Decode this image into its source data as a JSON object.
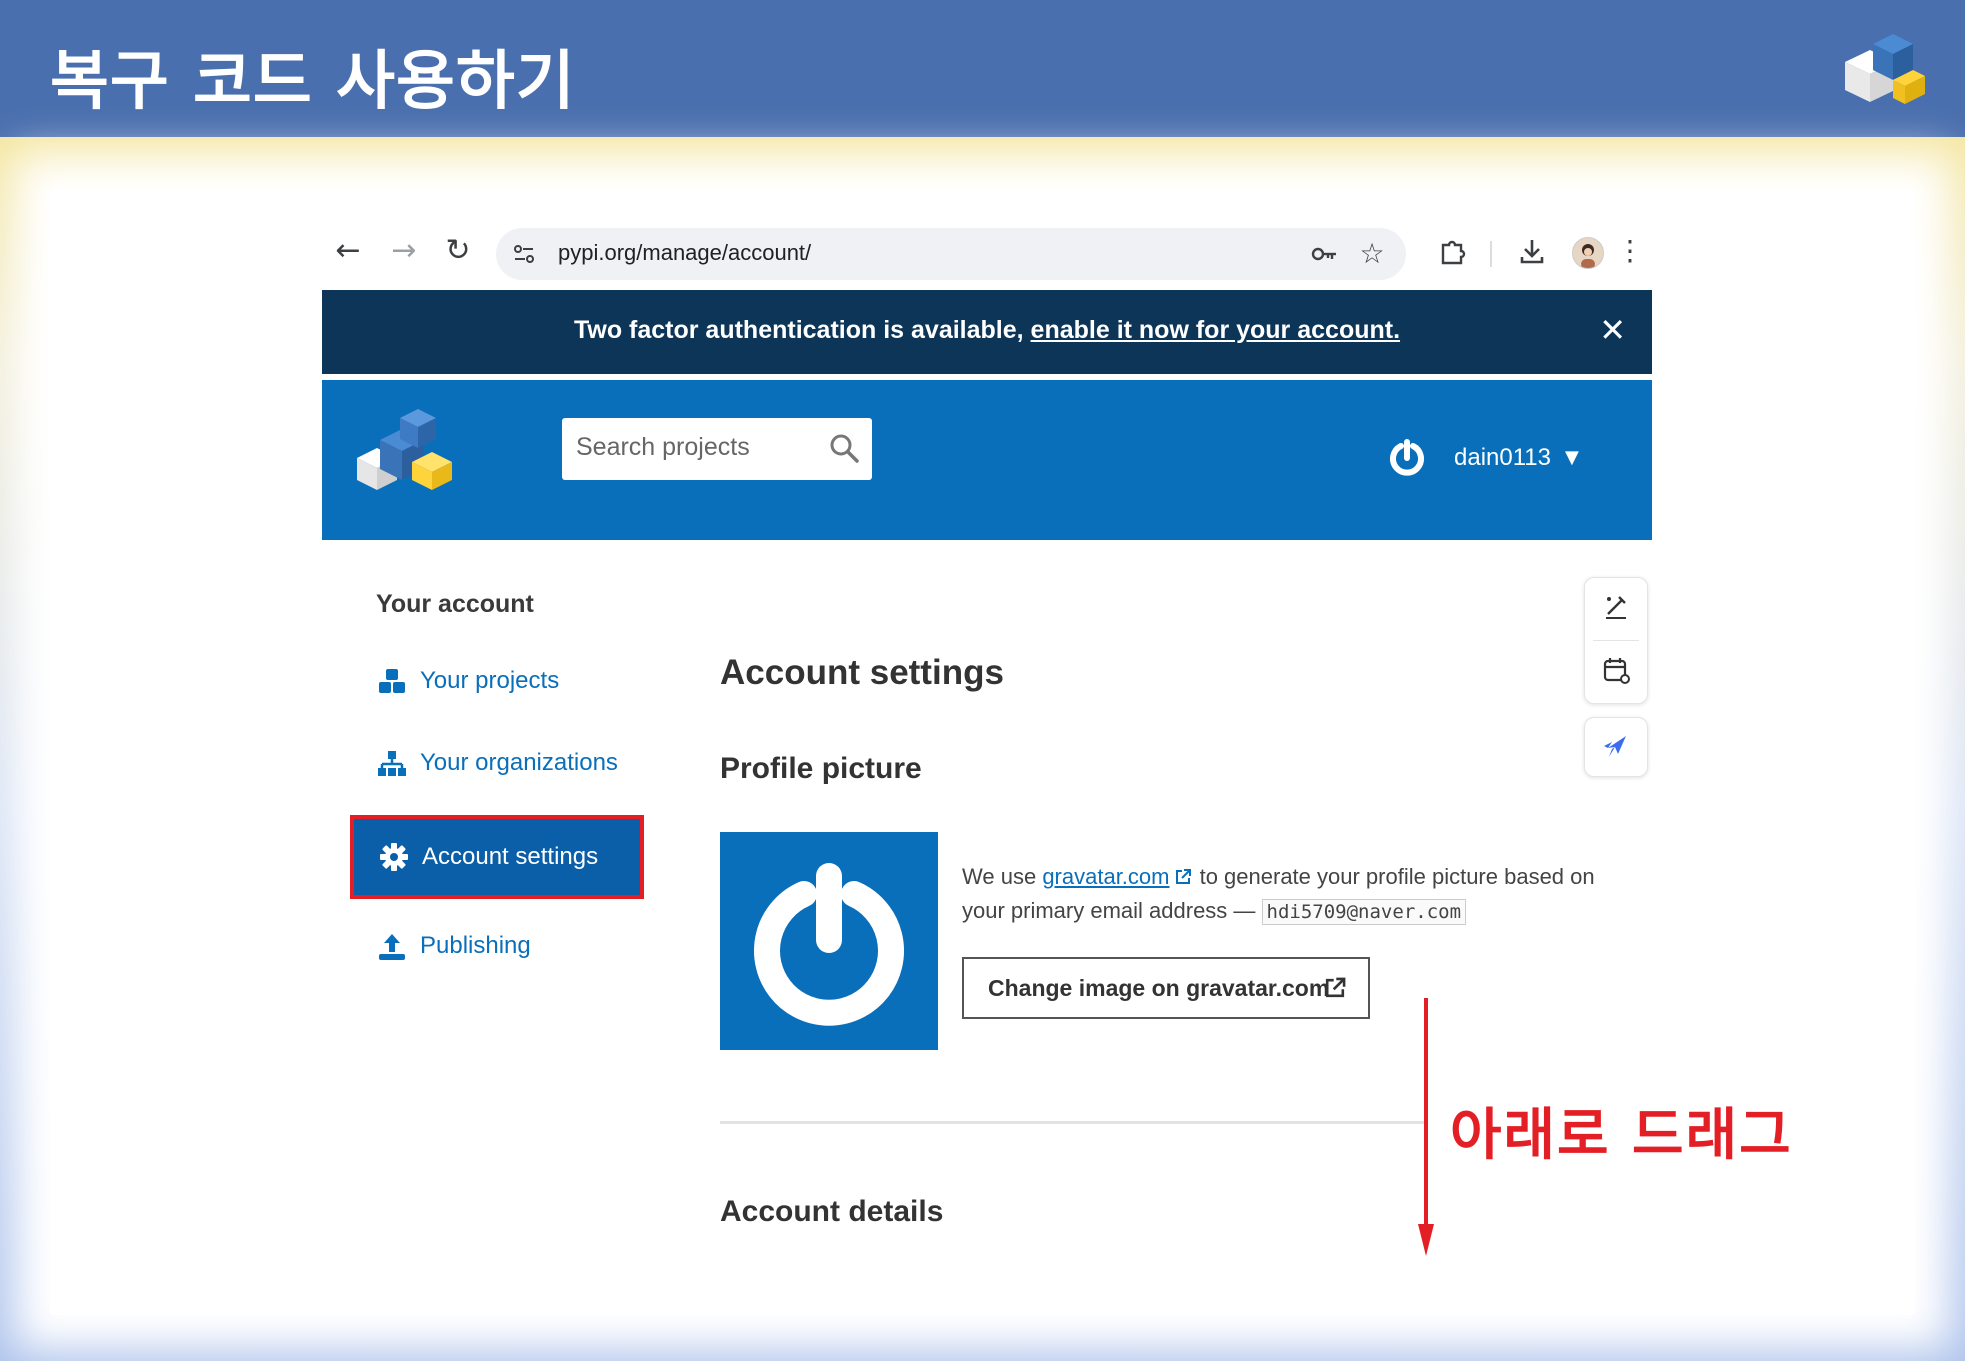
{
  "slide": {
    "title": "복구 코드 사용하기",
    "annotation": "아래로 드래그"
  },
  "browser": {
    "url": "pypi.org/manage/account/",
    "icons": [
      "back-icon",
      "forward-icon",
      "reload-icon",
      "site-info-icon",
      "key-icon",
      "star-icon",
      "extensions-icon",
      "download-icon",
      "avatar",
      "menu-icon"
    ]
  },
  "banner": {
    "text": "Two factor authentication is available, ",
    "link": "enable it now for your account.",
    "close": "✕"
  },
  "header": {
    "search_placeholder": "Search projects",
    "username": "dain0113"
  },
  "sidebar": {
    "heading": "Your account",
    "items": [
      {
        "label": "Your projects",
        "icon": "cubes-icon"
      },
      {
        "label": "Your organizations",
        "icon": "sitemap-icon"
      },
      {
        "label": "Account settings",
        "icon": "gear-icon",
        "active": true
      },
      {
        "label": "Publishing",
        "icon": "upload-icon"
      }
    ]
  },
  "main": {
    "title": "Account settings",
    "profile_heading": "Profile picture",
    "profile_text_1": "We use ",
    "profile_link": "gravatar.com",
    "profile_text_2": " to generate your profile picture based on your primary email address — ",
    "email": "hdi5709@naver.com",
    "change_button": "Change image on gravatar.com",
    "details_heading": "Account details"
  },
  "colors": {
    "slide_header": "#4A6FAE",
    "banner": "#0D3558",
    "pypi_blue": "#0A6FBA",
    "highlight": "#E31E24"
  }
}
